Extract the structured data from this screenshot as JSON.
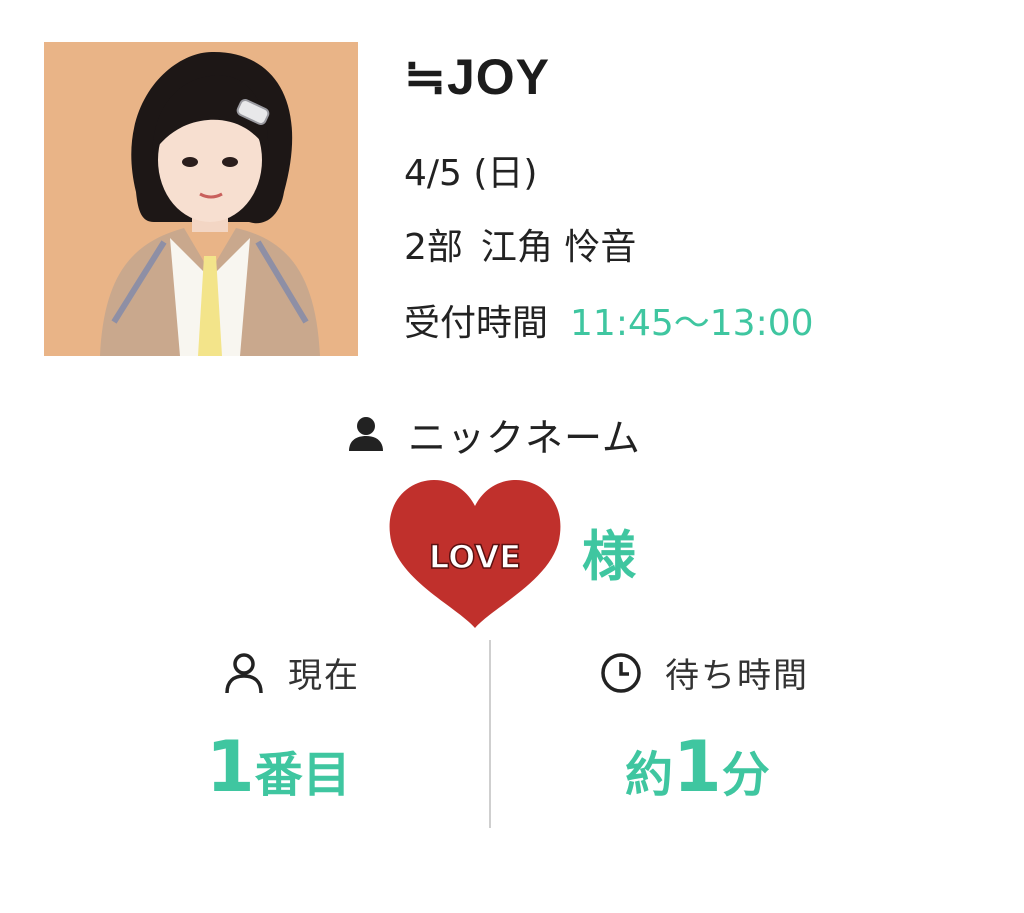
{
  "event": {
    "group_name": "≒JOY",
    "date": "4/5 (日)",
    "part": "2部",
    "member": "江角 怜音",
    "reception_label": "受付時間",
    "reception_time": "11:45〜13:00"
  },
  "user": {
    "nickname_label": "ニックネーム",
    "name_badge": "LOVE",
    "honorific": "様"
  },
  "status": {
    "current_label": "現在",
    "position_number": "1",
    "position_unit": "番目",
    "wait_label": "待ち時間",
    "wait_prefix": "約",
    "wait_number": "1",
    "wait_unit": "分"
  },
  "colors": {
    "accent": "#3fc6a0",
    "heart": "#c0302c",
    "photo_bg": "#e9b487"
  },
  "icons": [
    "person-icon",
    "user-outline-icon",
    "clock-icon"
  ]
}
